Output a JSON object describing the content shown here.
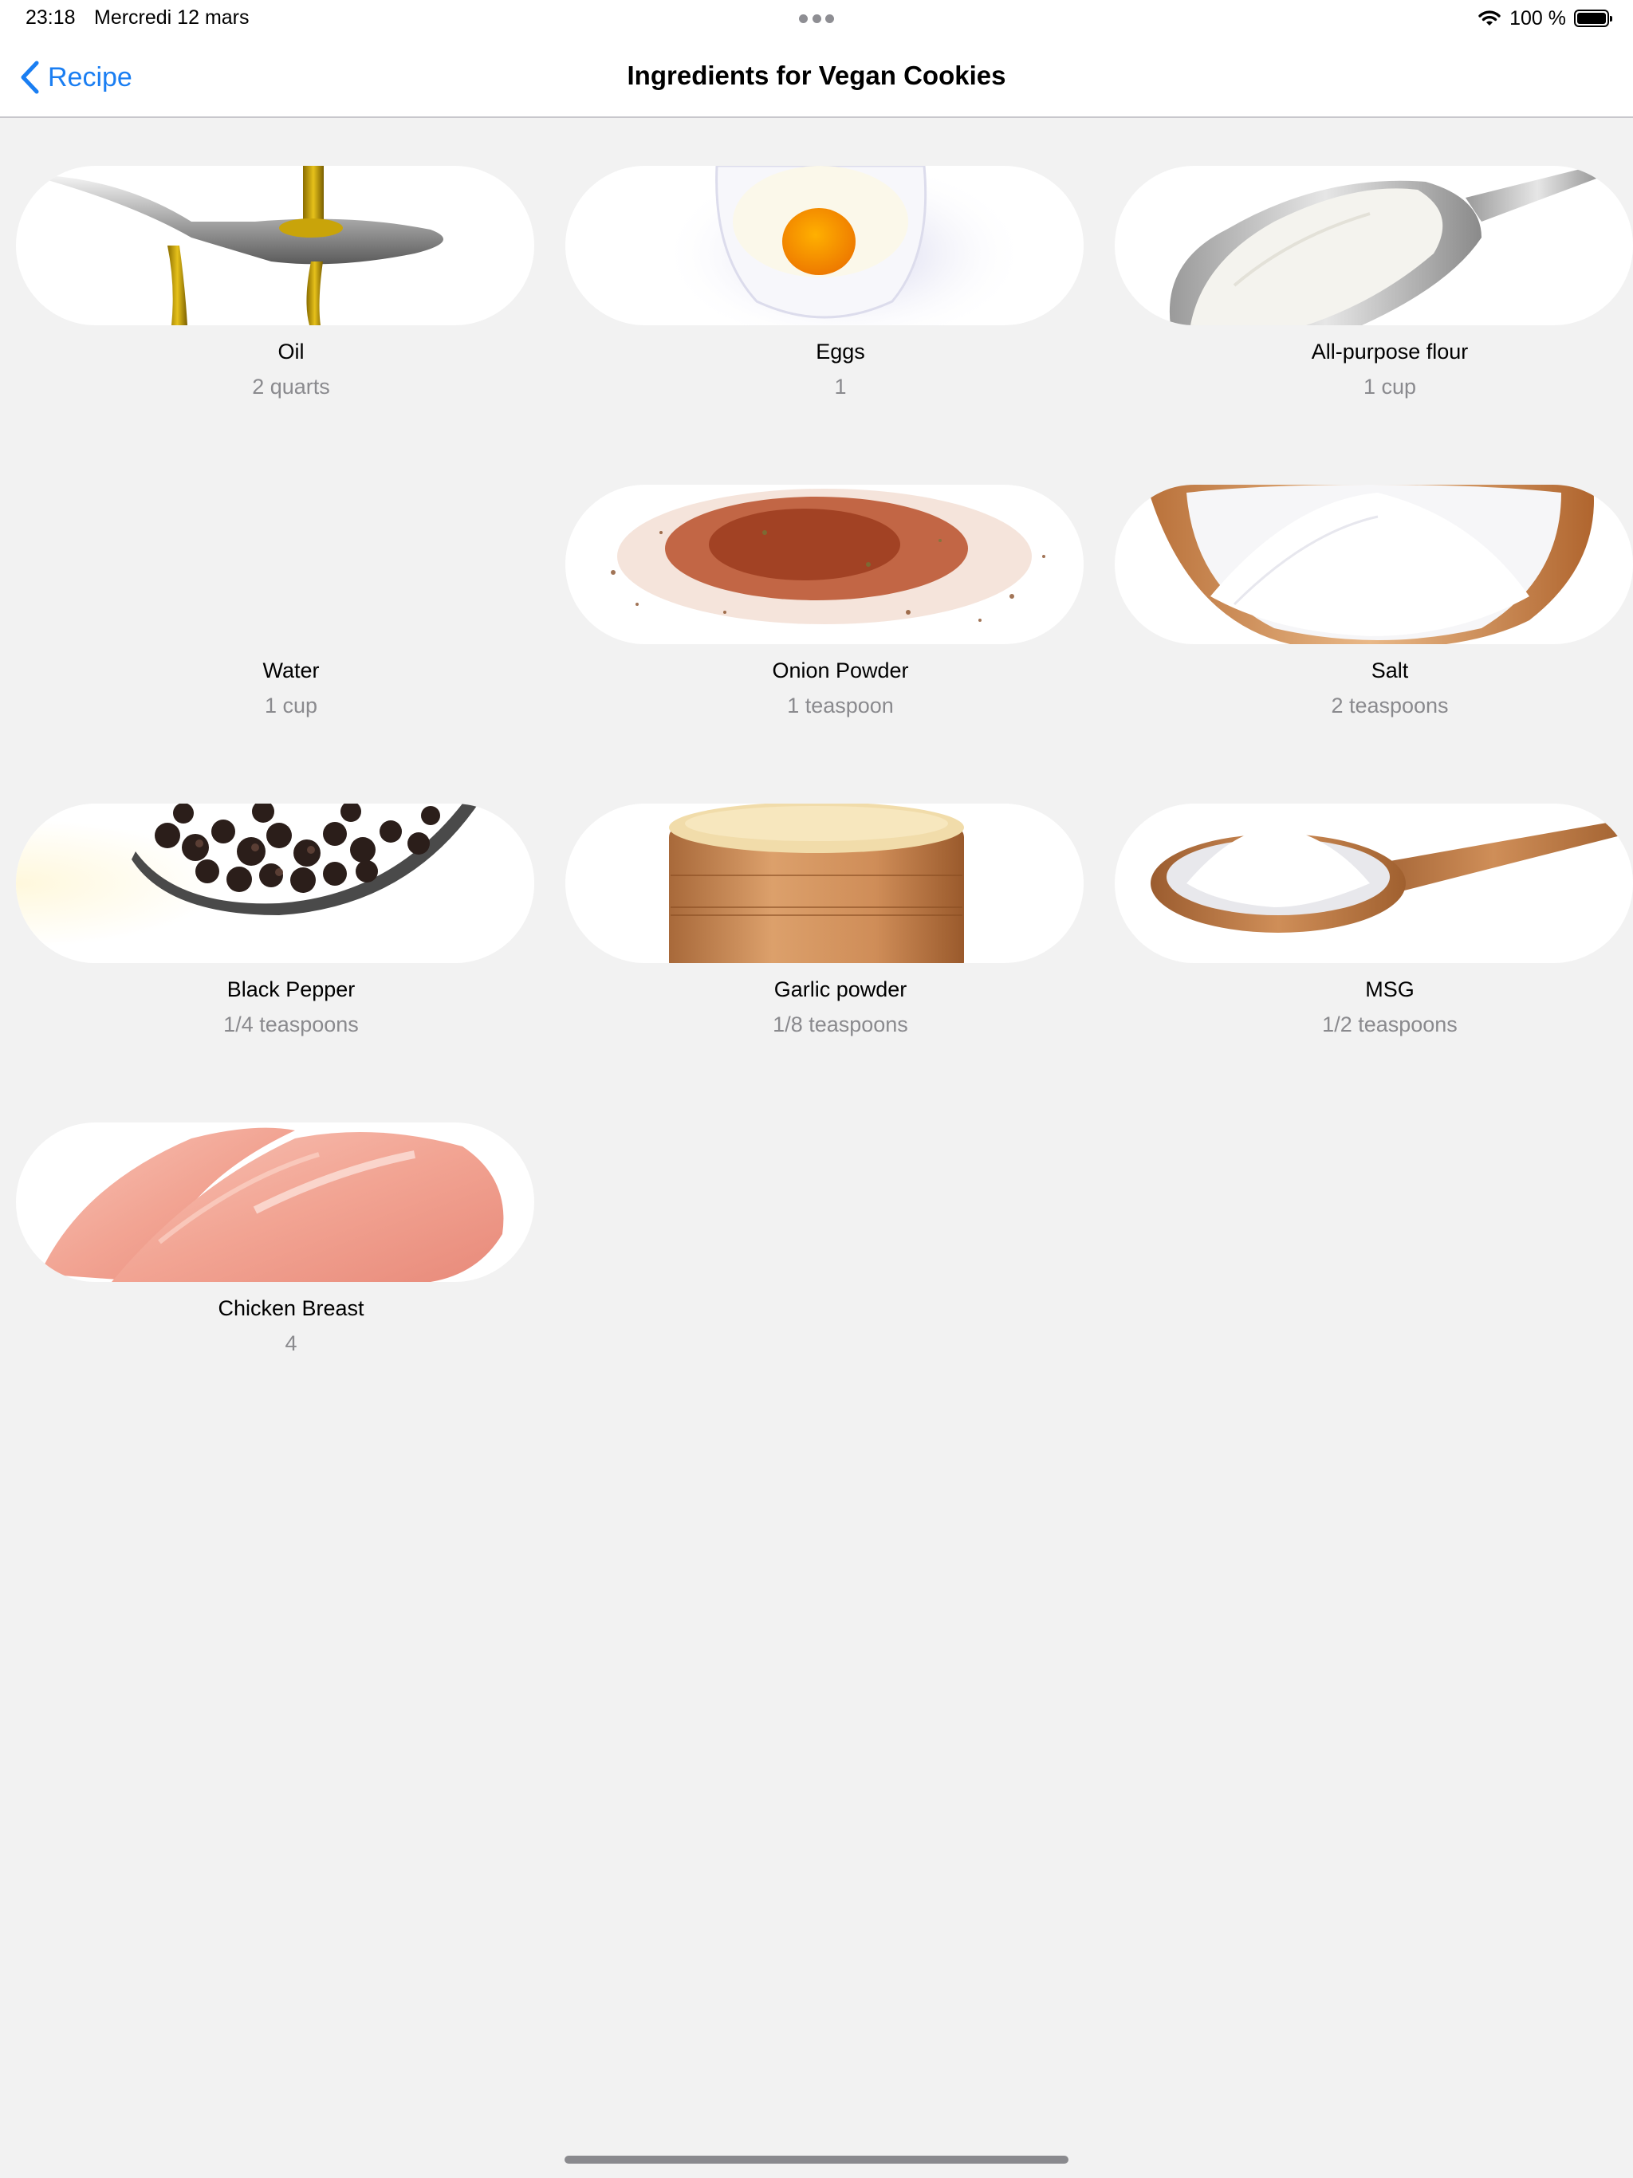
{
  "status_bar": {
    "time": "23:18",
    "date": "Mercredi 12 mars",
    "battery": "100 %",
    "icons": [
      "wifi-icon",
      "battery-icon"
    ]
  },
  "nav": {
    "back_label": "Recipe",
    "title": "Ingredients for Vegan Cookies",
    "accent_color": "#1a7ef2"
  },
  "ingredients": [
    {
      "name": "Oil",
      "quantity": "2 quarts",
      "image": "oil-spoon"
    },
    {
      "name": "Eggs",
      "quantity": "1",
      "image": "egg-bowl"
    },
    {
      "name": "All-purpose flour",
      "quantity": "1 cup",
      "image": "flour-scoop"
    },
    {
      "name": "Water",
      "quantity": "1 cup",
      "image": ""
    },
    {
      "name": "Onion Powder",
      "quantity": "1 teaspoon",
      "image": "spice-pile"
    },
    {
      "name": "Salt",
      "quantity": "2 teaspoons",
      "image": "salt-bowl"
    },
    {
      "name": "Black Pepper",
      "quantity": "1/4 teaspoons",
      "image": "pepper-spoon"
    },
    {
      "name": "Garlic powder",
      "quantity": "1/8 teaspoons",
      "image": "garlic-wood-bowl"
    },
    {
      "name": "MSG",
      "quantity": "1/2 teaspoons",
      "image": "msg-spoon"
    },
    {
      "name": "Chicken Breast",
      "quantity": "4",
      "image": "chicken-breast"
    }
  ]
}
